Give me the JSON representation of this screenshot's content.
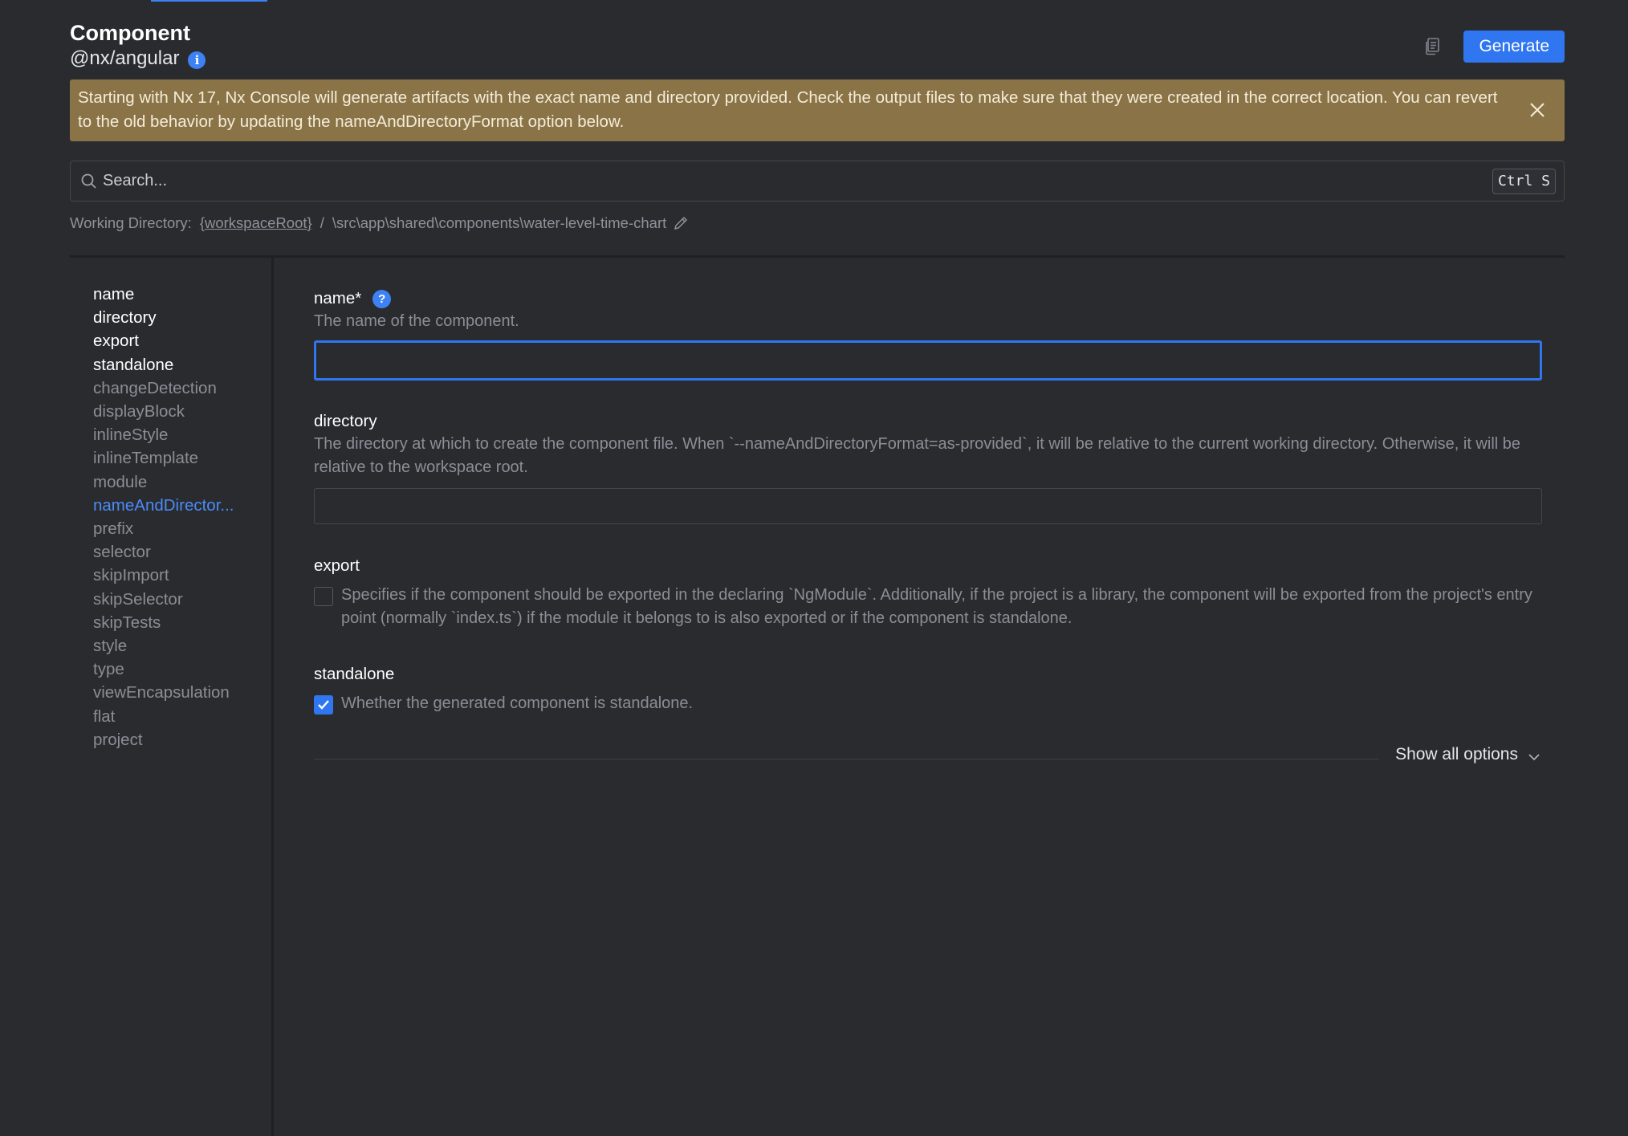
{
  "header": {
    "title": "Component",
    "subtitle": "@nx/angular",
    "info_icon": "info-icon",
    "copy_icon": "copy-icon",
    "generate_label": "Generate"
  },
  "banner": {
    "text": "Starting with Nx 17, Nx Console will generate artifacts with the exact name and directory provided. Check the output files to make sure that they were created in the correct location. You can revert to the old behavior by updating the nameAndDirectoryFormat option below.",
    "color": "#8a7447"
  },
  "search": {
    "placeholder": "Search...",
    "shortcut": "Ctrl S"
  },
  "working_directory": {
    "label": "Working Directory:",
    "root": "{workspaceRoot}",
    "separator": "/",
    "path": "\\src\\app\\shared\\components\\water-level-time-chart"
  },
  "nav": {
    "items": [
      {
        "label": "name",
        "state": "set"
      },
      {
        "label": "directory",
        "state": "set"
      },
      {
        "label": "export",
        "state": "set"
      },
      {
        "label": "standalone",
        "state": "set"
      },
      {
        "label": "changeDetection",
        "state": "default"
      },
      {
        "label": "displayBlock",
        "state": "default"
      },
      {
        "label": "inlineStyle",
        "state": "default"
      },
      {
        "label": "inlineTemplate",
        "state": "default"
      },
      {
        "label": "module",
        "state": "default"
      },
      {
        "label": "nameAndDirector...",
        "state": "active"
      },
      {
        "label": "prefix",
        "state": "default"
      },
      {
        "label": "selector",
        "state": "default"
      },
      {
        "label": "skipImport",
        "state": "default"
      },
      {
        "label": "skipSelector",
        "state": "default"
      },
      {
        "label": "skipTests",
        "state": "default"
      },
      {
        "label": "style",
        "state": "default"
      },
      {
        "label": "type",
        "state": "default"
      },
      {
        "label": "viewEncapsulation",
        "state": "default"
      },
      {
        "label": "flat",
        "state": "default"
      },
      {
        "label": "project",
        "state": "default"
      }
    ]
  },
  "fields": {
    "name": {
      "label": "name*",
      "description": "The name of the component.",
      "value": ""
    },
    "directory": {
      "label": "directory",
      "description": "The directory at which to create the component file. When `--nameAndDirectoryFormat=as-provided`, it will be relative to the current working directory. Otherwise, it will be relative to the workspace root.",
      "value": ""
    },
    "export": {
      "label": "export",
      "description": "Specifies if the component should be exported in the declaring `NgModule`. Additionally, if the project is a library, the component will be exported from the project's entry point (normally `index.ts`) if the module it belongs to is also exported or if the component is standalone.",
      "checked": false
    },
    "standalone": {
      "label": "standalone",
      "description": "Whether the generated component is standalone.",
      "checked": true
    }
  },
  "show_all_label": "Show all options",
  "colors": {
    "accent": "#2f76f0",
    "background": "#2a2b2f",
    "active_nav": "#4a8cf7"
  }
}
